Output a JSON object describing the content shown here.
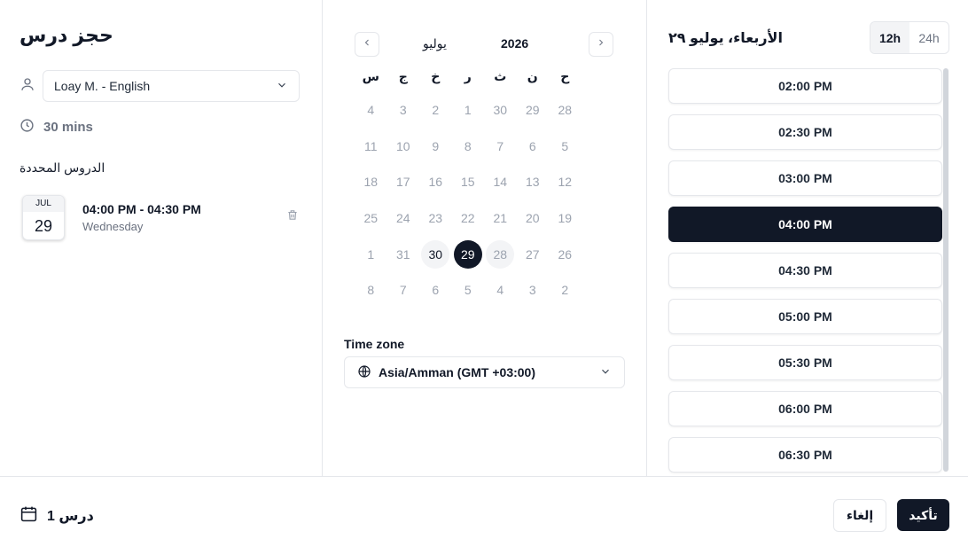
{
  "left": {
    "title": "حجز درس",
    "teacher": {
      "value": "Loay M. - English",
      "icon": "user-icon"
    },
    "duration": "30 mins",
    "selected_heading": "الدروس المحددة",
    "lessons": [
      {
        "month": "JUL",
        "day": "29",
        "time": "04:00 PM - 04:30 PM",
        "weekday": "Wednesday"
      }
    ]
  },
  "calendar": {
    "month": "يوليو",
    "year": "2026",
    "weekdays": [
      "س",
      "ج",
      "خ",
      "ر",
      "ث",
      "ن",
      "ح"
    ],
    "weeks": [
      [
        {
          "d": "4",
          "s": ""
        },
        {
          "d": "3",
          "s": ""
        },
        {
          "d": "2",
          "s": ""
        },
        {
          "d": "1",
          "s": ""
        },
        {
          "d": "30",
          "s": ""
        },
        {
          "d": "29",
          "s": ""
        },
        {
          "d": "28",
          "s": ""
        }
      ],
      [
        {
          "d": "11",
          "s": ""
        },
        {
          "d": "10",
          "s": ""
        },
        {
          "d": "9",
          "s": ""
        },
        {
          "d": "8",
          "s": ""
        },
        {
          "d": "7",
          "s": ""
        },
        {
          "d": "6",
          "s": ""
        },
        {
          "d": "5",
          "s": ""
        }
      ],
      [
        {
          "d": "18",
          "s": ""
        },
        {
          "d": "17",
          "s": ""
        },
        {
          "d": "16",
          "s": ""
        },
        {
          "d": "15",
          "s": ""
        },
        {
          "d": "14",
          "s": ""
        },
        {
          "d": "13",
          "s": ""
        },
        {
          "d": "12",
          "s": ""
        }
      ],
      [
        {
          "d": "25",
          "s": ""
        },
        {
          "d": "24",
          "s": ""
        },
        {
          "d": "23",
          "s": ""
        },
        {
          "d": "22",
          "s": ""
        },
        {
          "d": "21",
          "s": ""
        },
        {
          "d": "20",
          "s": ""
        },
        {
          "d": "19",
          "s": ""
        }
      ],
      [
        {
          "d": "1",
          "s": ""
        },
        {
          "d": "31",
          "s": ""
        },
        {
          "d": "30",
          "s": "avail"
        },
        {
          "d": "29",
          "s": "sel"
        },
        {
          "d": "28",
          "s": "past"
        },
        {
          "d": "27",
          "s": ""
        },
        {
          "d": "26",
          "s": ""
        }
      ],
      [
        {
          "d": "8",
          "s": ""
        },
        {
          "d": "7",
          "s": ""
        },
        {
          "d": "6",
          "s": ""
        },
        {
          "d": "5",
          "s": ""
        },
        {
          "d": "4",
          "s": ""
        },
        {
          "d": "3",
          "s": ""
        },
        {
          "d": "2",
          "s": ""
        }
      ]
    ],
    "timezone_label": "Time zone",
    "timezone_value": "Asia/Amman (GMT +03:00)"
  },
  "right": {
    "day_heading": "الأربعاء، يوليو ٢٩",
    "format_options": [
      "12h",
      "24h"
    ],
    "format_selected": "12h",
    "slots": [
      {
        "t": "02:00 PM",
        "sel": false
      },
      {
        "t": "02:30 PM",
        "sel": false
      },
      {
        "t": "03:00 PM",
        "sel": false
      },
      {
        "t": "04:00 PM",
        "sel": true
      },
      {
        "t": "04:30 PM",
        "sel": false
      },
      {
        "t": "05:00 PM",
        "sel": false
      },
      {
        "t": "05:30 PM",
        "sel": false
      },
      {
        "t": "06:00 PM",
        "sel": false
      },
      {
        "t": "06:30 PM",
        "sel": false
      }
    ]
  },
  "footer": {
    "count_label": "درس 1",
    "cancel_label": "إلغاء",
    "confirm_label": "تأكيد"
  },
  "colors": {
    "primary": "#111827",
    "muted": "#6b7280",
    "border": "#e5e7eb",
    "chip": "#f3f4f6"
  }
}
